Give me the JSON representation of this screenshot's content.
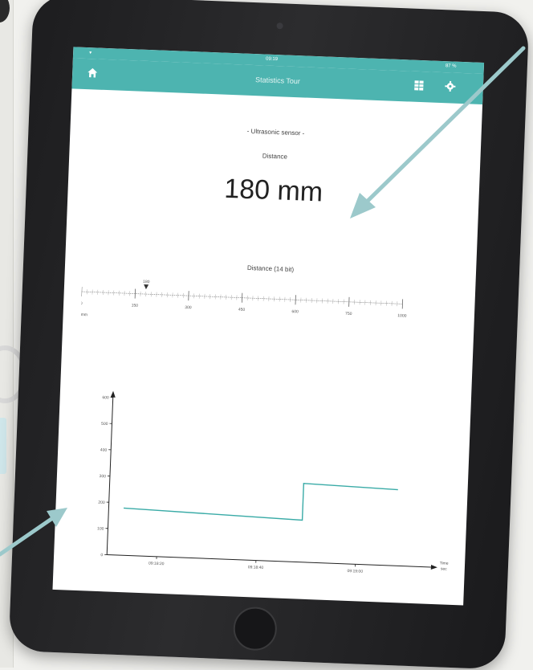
{
  "status_bar": {
    "time": "09:19",
    "battery": "87 %"
  },
  "header": {
    "title": "Statistics Tour",
    "home_icon": "home-icon",
    "table_icon": "table-icon",
    "settings_icon": "gear-icon",
    "color": "#4db4b0"
  },
  "sensor": {
    "name": "- Ultrasonic sensor -",
    "reading_label": "Distance",
    "reading_value": "180 mm"
  },
  "slider": {
    "title": "Distance (14 bit)",
    "marker_label": "180",
    "marker_value": 180,
    "min": 0,
    "max": 2000,
    "ticks": [
      "0",
      "150",
      "300",
      "450",
      "600",
      "750",
      "1000"
    ],
    "unit": "mm"
  },
  "chart_data": {
    "type": "line",
    "title": "",
    "xlabel": "Time",
    "x_unit": "sec",
    "ylabel": "",
    "ylim": [
      0,
      600
    ],
    "yticks": [
      0,
      100,
      200,
      300,
      400,
      500,
      600
    ],
    "xticks": [
      "09:18:20",
      "09:18:40",
      "09:19:00"
    ],
    "series": [
      {
        "x": [
          "09:18:13",
          "09:18:49",
          "09:18:49",
          "09:19:08"
        ],
        "values": [
          180,
          160,
          300,
          290
        ]
      }
    ],
    "line_color": "#3aaba7",
    "grid": false
  }
}
